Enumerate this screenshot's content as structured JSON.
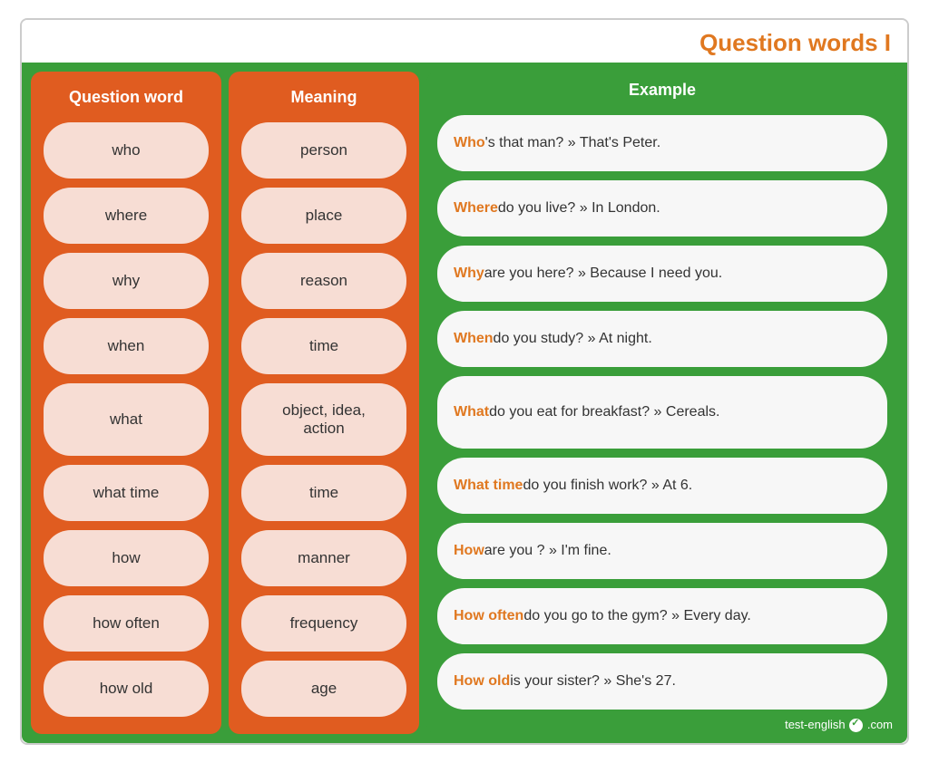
{
  "page": {
    "title": "Question words I",
    "footer": "test-english",
    "footer_domain": ".com",
    "columns": {
      "question_word": "Question word",
      "meaning": "Meaning",
      "example": "Example"
    },
    "rows": [
      {
        "question_word": "who",
        "meaning": "person",
        "example_keyword": "Who",
        "example_rest": "'s that man? » That's Peter."
      },
      {
        "question_word": "where",
        "meaning": "place",
        "example_keyword": "Where",
        "example_rest": " do you live? » In London."
      },
      {
        "question_word": "why",
        "meaning": "reason",
        "example_keyword": "Why",
        "example_rest": " are you here? » Because I need you."
      },
      {
        "question_word": "when",
        "meaning": "time",
        "example_keyword": "When",
        "example_rest": " do you study? » At night."
      },
      {
        "question_word": "what",
        "meaning": "object, idea,\naction",
        "example_keyword": "What",
        "example_rest": " do you eat for breakfast? » Cereals."
      },
      {
        "question_word": "what time",
        "meaning": "time",
        "example_keyword": "What time",
        "example_rest": " do you finish work? » At 6."
      },
      {
        "question_word": "how",
        "meaning": "manner",
        "example_keyword": "How",
        "example_rest": " are you ? » I'm fine."
      },
      {
        "question_word": "how often",
        "meaning": "frequency",
        "example_keyword": "How often",
        "example_rest": " do you go to the gym? » Every day."
      },
      {
        "question_word": "how old",
        "meaning": "age",
        "example_keyword": "How old",
        "example_rest": " is your sister? » She's 27."
      }
    ]
  }
}
